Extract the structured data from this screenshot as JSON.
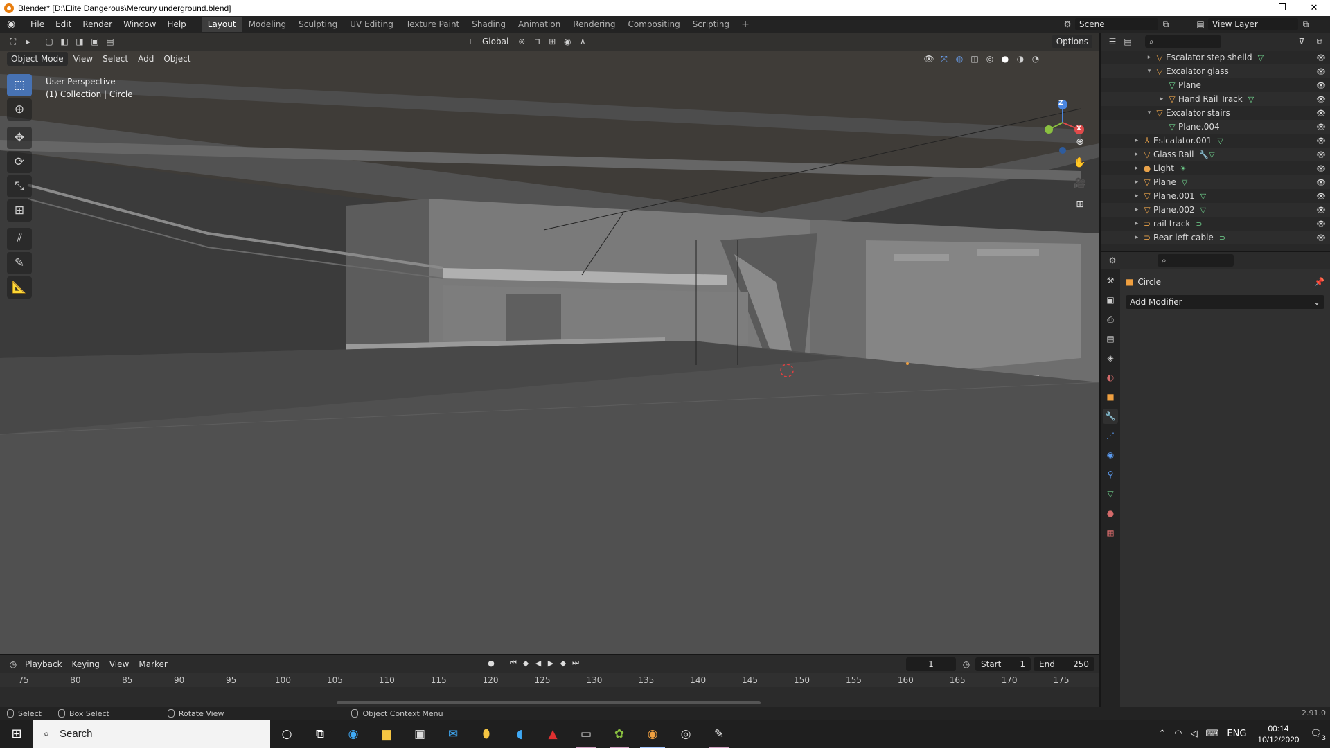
{
  "window": {
    "title": "Blender* [D:\\Elite Dangerous\\Mercury underground.blend]",
    "controls": [
      "—",
      "❐",
      "✕"
    ]
  },
  "menu": [
    "File",
    "Edit",
    "Render",
    "Window",
    "Help"
  ],
  "workspaces": [
    {
      "label": "Layout",
      "active": true
    },
    {
      "label": "Modeling",
      "active": false
    },
    {
      "label": "Sculpting",
      "active": false
    },
    {
      "label": "UV Editing",
      "active": false
    },
    {
      "label": "Texture Paint",
      "active": false
    },
    {
      "label": "Shading",
      "active": false
    },
    {
      "label": "Animation",
      "active": false
    },
    {
      "label": "Rendering",
      "active": false
    },
    {
      "label": "Compositing",
      "active": false
    },
    {
      "label": "Scripting",
      "active": false
    }
  ],
  "scene": {
    "label": "Scene"
  },
  "view_layer": {
    "label": "View Layer"
  },
  "viewport": {
    "mode": "Object Mode",
    "menus": [
      "View",
      "Select",
      "Add",
      "Object"
    ],
    "transform_orientation": "Global",
    "options_label": "Options",
    "info_line1": "User Perspective",
    "info_line2": "(1) Collection | Circle",
    "gizmo": {
      "x": "X",
      "z": "Z"
    }
  },
  "toolbar_icons": [
    "select-box-icon",
    "cursor-icon",
    "move-icon",
    "rotate-icon",
    "scale-icon",
    "transform-icon",
    "annotate-icon",
    "annotate-line-icon",
    "measure-icon"
  ],
  "timeline": {
    "menus": [
      "Playback",
      "Keying",
      "View",
      "Marker"
    ],
    "current_frame": "1",
    "start_label": "Start",
    "start_value": "1",
    "end_label": "End",
    "end_value": "250",
    "ticks": [
      "75",
      "80",
      "85",
      "90",
      "95",
      "100",
      "105",
      "110",
      "115",
      "120",
      "125",
      "130",
      "135",
      "140",
      "145",
      "150",
      "155",
      "160",
      "165",
      "170",
      "175"
    ]
  },
  "statusbar": {
    "select": "Select",
    "box_select": "Box Select",
    "rotate_view": "Rotate View",
    "context_menu": "Object Context Menu",
    "version": "2.91.0"
  },
  "outliner": {
    "rows": [
      {
        "label": "Escalator step sheild",
        "indent": 2,
        "arrow": "▸",
        "icon": "▽",
        "color": "#e8a24a",
        "sub": "▽"
      },
      {
        "label": "Excalator glass",
        "indent": 2,
        "arrow": "▾",
        "icon": "▽",
        "color": "#e8a24a",
        "sub": ""
      },
      {
        "label": "Plane",
        "indent": 3,
        "arrow": "",
        "icon": "▽",
        "color": "#6fd08c",
        "sub": ""
      },
      {
        "label": "Hand Rail Track",
        "indent": 3,
        "arrow": "▸",
        "icon": "▽",
        "color": "#e8a24a",
        "sub": "▽"
      },
      {
        "label": "Excalator stairs",
        "indent": 2,
        "arrow": "▾",
        "icon": "▽",
        "color": "#e8a24a",
        "sub": ""
      },
      {
        "label": "Plane.004",
        "indent": 3,
        "arrow": "",
        "icon": "▽",
        "color": "#6fd08c",
        "sub": ""
      },
      {
        "label": "Eslcalator.001",
        "indent": 1,
        "arrow": "▸",
        "icon": "⅄",
        "color": "#e8a24a",
        "sub": "▽"
      },
      {
        "label": "Glass Rail",
        "indent": 1,
        "arrow": "▸",
        "icon": "▽",
        "color": "#e8a24a",
        "sub": "🔧▽"
      },
      {
        "label": "Light",
        "indent": 1,
        "arrow": "▸",
        "icon": "●",
        "color": "#e8a24a",
        "sub": "☀"
      },
      {
        "label": "Plane",
        "indent": 1,
        "arrow": "▸",
        "icon": "▽",
        "color": "#e8a24a",
        "sub": "▽"
      },
      {
        "label": "Plane.001",
        "indent": 1,
        "arrow": "▸",
        "icon": "▽",
        "color": "#e8a24a",
        "sub": "▽"
      },
      {
        "label": "Plane.002",
        "indent": 1,
        "arrow": "▸",
        "icon": "▽",
        "color": "#e8a24a",
        "sub": "▽"
      },
      {
        "label": "rail track",
        "indent": 1,
        "arrow": "▸",
        "icon": "⊃",
        "color": "#e8a24a",
        "sub": "⊃"
      },
      {
        "label": "Rear left cable",
        "indent": 1,
        "arrow": "▸",
        "icon": "⊃",
        "color": "#e8a24a",
        "sub": "⊃"
      }
    ]
  },
  "properties": {
    "object_name": "Circle",
    "add_modifier": "Add Modifier",
    "tabs": [
      {
        "name": "tool-tab-icon",
        "glyph": "⚒",
        "color": "#cfcfcf"
      },
      {
        "name": "render-tab-icon",
        "glyph": "▣",
        "color": "#cfcfcf"
      },
      {
        "name": "output-tab-icon",
        "glyph": "⎙",
        "color": "#cfcfcf"
      },
      {
        "name": "view-layer-tab-icon",
        "glyph": "▤",
        "color": "#cfcfcf"
      },
      {
        "name": "scene-tab-icon",
        "glyph": "◈",
        "color": "#cfcfcf"
      },
      {
        "name": "world-tab-icon",
        "glyph": "◐",
        "color": "#d46a6a"
      },
      {
        "name": "object-tab-icon",
        "glyph": "■",
        "color": "#f0a040"
      },
      {
        "name": "modifier-tab-icon",
        "glyph": "🔧",
        "color": "#5b9bf0"
      },
      {
        "name": "particles-tab-icon",
        "glyph": "⋰",
        "color": "#5b9bf0"
      },
      {
        "name": "physics-tab-icon",
        "glyph": "◉",
        "color": "#5b9bf0"
      },
      {
        "name": "constraints-tab-icon",
        "glyph": "⚲",
        "color": "#5b9bf0"
      },
      {
        "name": "data-tab-icon",
        "glyph": "▽",
        "color": "#6fd08c"
      },
      {
        "name": "material-tab-icon",
        "glyph": "●",
        "color": "#d46a6a"
      },
      {
        "name": "texture-tab-icon",
        "glyph": "▦",
        "color": "#d46a6a"
      }
    ]
  },
  "taskbar": {
    "search_placeholder": "Search",
    "lang": "ENG",
    "time": "00:14",
    "date": "10/12/2020",
    "notifications": "3"
  }
}
